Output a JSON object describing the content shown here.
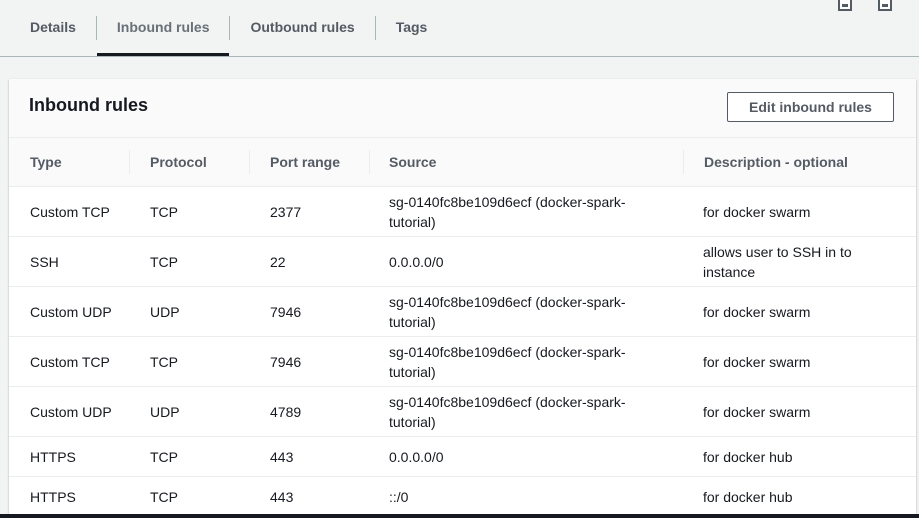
{
  "tabs": [
    {
      "label": "Details",
      "active": false
    },
    {
      "label": "Inbound rules",
      "active": true
    },
    {
      "label": "Outbound rules",
      "active": false
    },
    {
      "label": "Tags",
      "active": false
    }
  ],
  "panel": {
    "title": "Inbound rules",
    "edit_button": "Edit inbound rules"
  },
  "table": {
    "columns": [
      "Type",
      "Protocol",
      "Port range",
      "Source",
      "Description - optional"
    ],
    "rows": [
      {
        "type": "Custom TCP",
        "protocol": "TCP",
        "port": "2377",
        "source": "sg-0140fc8be109d6ecf (docker-spark-tutorial)",
        "description": "for docker swarm"
      },
      {
        "type": "SSH",
        "protocol": "TCP",
        "port": "22",
        "source": "0.0.0.0/0",
        "description": "allows user to SSH in to instance"
      },
      {
        "type": "Custom UDP",
        "protocol": "UDP",
        "port": "7946",
        "source": "sg-0140fc8be109d6ecf (docker-spark-tutorial)",
        "description": "for docker swarm"
      },
      {
        "type": "Custom TCP",
        "protocol": "TCP",
        "port": "7946",
        "source": "sg-0140fc8be109d6ecf (docker-spark-tutorial)",
        "description": "for docker swarm"
      },
      {
        "type": "Custom UDP",
        "protocol": "UDP",
        "port": "4789",
        "source": "sg-0140fc8be109d6ecf (docker-spark-tutorial)",
        "description": "for docker swarm"
      },
      {
        "type": "HTTPS",
        "protocol": "TCP",
        "port": "443",
        "source": "0.0.0.0/0",
        "description": "for docker hub"
      },
      {
        "type": "HTTPS",
        "protocol": "TCP",
        "port": "443",
        "source": "::/0",
        "description": "for docker hub"
      }
    ]
  },
  "icons": [
    "window-icon",
    "window-icon"
  ],
  "colors": {
    "accent": "#16191f",
    "text_secondary": "#545b64",
    "background": "#f2f3f3"
  }
}
